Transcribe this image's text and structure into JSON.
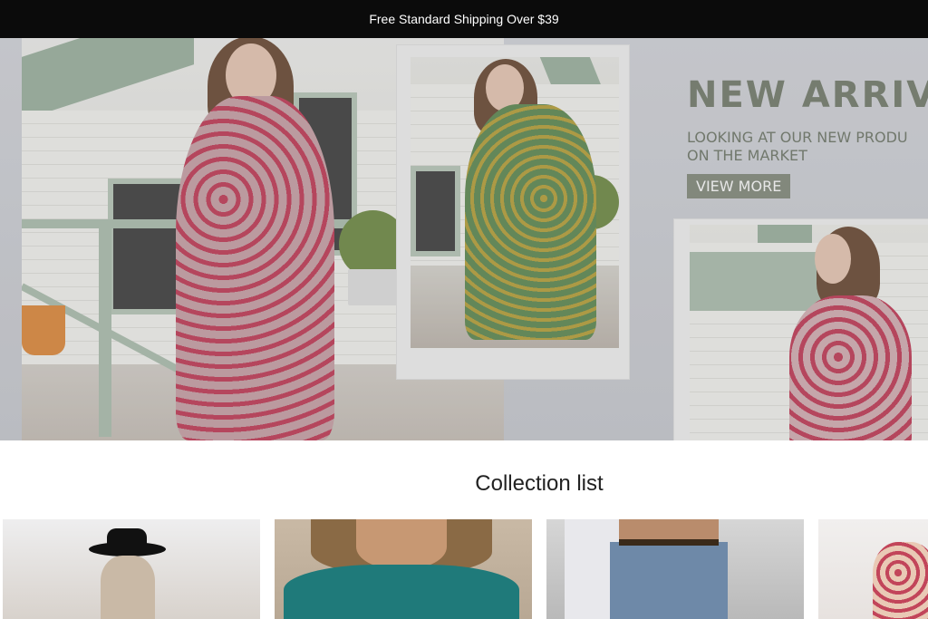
{
  "announcement": {
    "text": "Free Standard Shipping Over $39"
  },
  "hero": {
    "title": "NEW ARRIVE",
    "subtitle": "LOOKING AT OUR NEW PRODU\nON THE MARKET",
    "button_label": "VIEW MORE",
    "photos": [
      {
        "name": "model-pink-floral-dress"
      },
      {
        "name": "model-green-floral-dress"
      },
      {
        "name": "model-pink-dress-back"
      }
    ]
  },
  "collection": {
    "title": "Collection list",
    "cards": [
      {
        "name": "collection-hat"
      },
      {
        "name": "collection-teal-top"
      },
      {
        "name": "collection-denim"
      },
      {
        "name": "collection-floral"
      }
    ]
  },
  "colors": {
    "announcement_bg": "#0b0b0b",
    "hero_text": "#747d6d",
    "button_bg": "#848c7d"
  }
}
